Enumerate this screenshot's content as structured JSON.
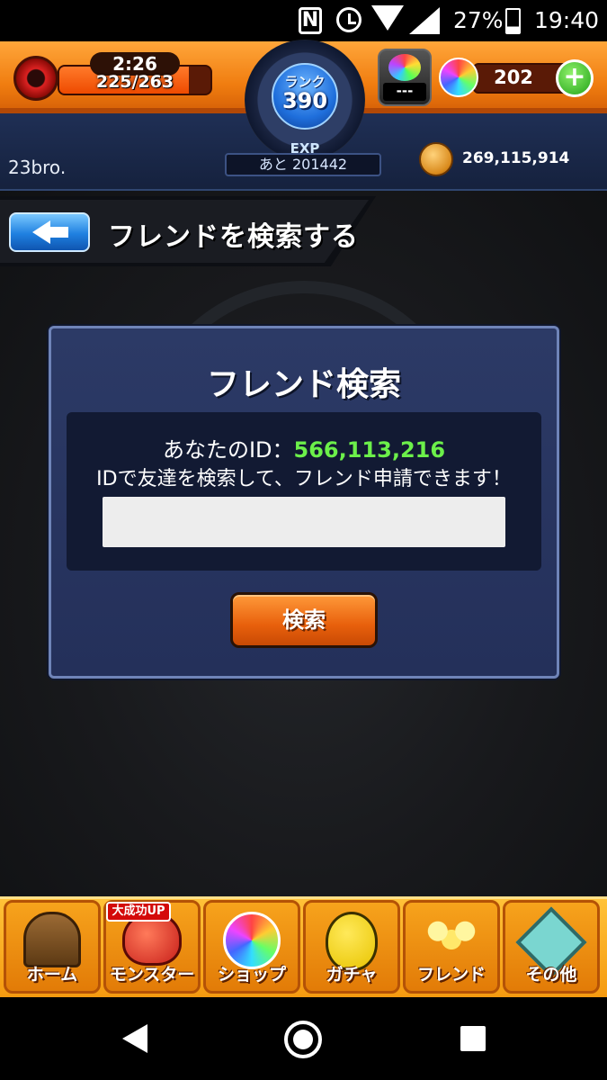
{
  "status_bar": {
    "battery": "27%",
    "time": "19:40",
    "nfc": "N"
  },
  "header": {
    "stamina_timer": "2:26",
    "stamina": "225/263",
    "stamina_fraction": 0.855,
    "rank_label": "ランク",
    "rank": "390",
    "exp_label": "EXP",
    "exp_remaining": "あと 201442",
    "egg_count": "---",
    "orb_count": "202",
    "orb_add": "+",
    "player_name": "23bro.",
    "gold": "269,115,914"
  },
  "title_bar": {
    "title": "フレンドを検索する"
  },
  "dialog": {
    "title": "フレンド検索",
    "id_label": "あなたのID：",
    "id_value": "566,113,216",
    "description": "IDで友達を検索して、フレンド申請できます！",
    "input_value": "",
    "search_button": "検索"
  },
  "bottom_nav": {
    "items": [
      {
        "label": "ホーム",
        "icon": "home-gate-icon"
      },
      {
        "label": "モンスター",
        "icon": "monster-icon",
        "badge": "大成功UP"
      },
      {
        "label": "ショップ",
        "icon": "rainbow-orb-icon"
      },
      {
        "label": "ガチャ",
        "icon": "egg-icon"
      },
      {
        "label": "フレンド",
        "icon": "friends-icon"
      },
      {
        "label": "その他",
        "icon": "other-menu-icon"
      }
    ]
  }
}
